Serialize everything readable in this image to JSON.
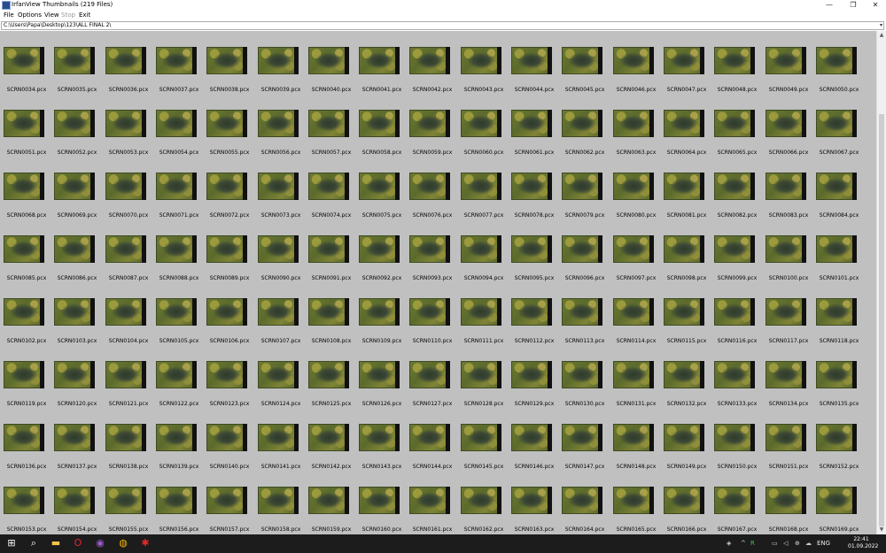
{
  "window": {
    "title": "IrfanView Thumbnails (219 Files)",
    "minimize_glyph": "—",
    "maximize_glyph": "❐",
    "close_glyph": "✕"
  },
  "menu": {
    "items": [
      {
        "label": "File",
        "enabled": true
      },
      {
        "label": "Options",
        "enabled": true
      },
      {
        "label": "View",
        "enabled": true
      },
      {
        "label": "Stop",
        "enabled": false
      },
      {
        "label": "Exit",
        "enabled": true
      }
    ]
  },
  "path": {
    "value": "C:\\Users\\Papa\\Desktop\\123\\ALL FINAL 2\\",
    "dropdown_glyph": "▾"
  },
  "thumbnails": {
    "prefix": "SCRN",
    "extension": ".pcx",
    "first_number": 34,
    "last_number": 169,
    "columns": 17,
    "rows": 8
  },
  "scrollbar": {
    "up_glyph": "▲",
    "down_glyph": "▼"
  },
  "taskbar": {
    "icons": [
      {
        "name": "windows-start-icon",
        "glyph": "⊞",
        "color": "#ffffff"
      },
      {
        "name": "search-icon",
        "glyph": "⌕",
        "color": "#ffffff"
      },
      {
        "name": "file-explorer-icon",
        "glyph": "▬",
        "color": "#f2c84b"
      },
      {
        "name": "opera-browser-icon",
        "glyph": "O",
        "color": "#e8232e"
      },
      {
        "name": "media-player-icon",
        "glyph": "◉",
        "color": "#9b59d0"
      },
      {
        "name": "chrome-browser-icon",
        "glyph": "◍",
        "color": "#f4b400"
      },
      {
        "name": "irfanview-app-icon",
        "glyph": "✱",
        "color": "#e02a2a"
      }
    ],
    "tray": [
      {
        "name": "tray-security-icon",
        "glyph": "◈",
        "color": "#cfcfcf"
      },
      {
        "name": "tray-chevron-icon",
        "glyph": "^",
        "color": "#cfcfcf"
      },
      {
        "name": "tray-app-icon",
        "glyph": "R",
        "color": "#3cc04a"
      },
      {
        "name": "tray-network-icon",
        "glyph": "▭",
        "color": "#cfcfcf"
      },
      {
        "name": "tray-volume-icon",
        "glyph": "◁",
        "color": "#cfcfcf"
      },
      {
        "name": "tray-language-icon",
        "glyph": "⊕",
        "color": "#cfcfcf"
      },
      {
        "name": "tray-onedrive-icon",
        "glyph": "☁",
        "color": "#cfcfcf"
      }
    ],
    "language": "ENG",
    "time": "22:41",
    "date": "01.09.2022"
  }
}
